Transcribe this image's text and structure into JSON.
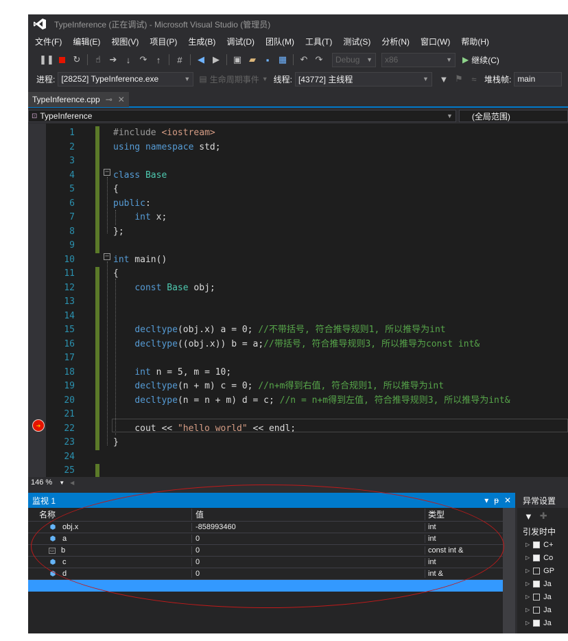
{
  "window": {
    "title": "TypeInference (正在调试) - Microsoft Visual Studio (管理员)"
  },
  "menu": [
    "文件(F)",
    "编辑(E)",
    "视图(V)",
    "项目(P)",
    "生成(B)",
    "调试(D)",
    "团队(M)",
    "工具(T)",
    "测试(S)",
    "分析(N)",
    "窗口(W)",
    "帮助(H)"
  ],
  "toolbar": {
    "config": "Debug",
    "platform": "x86",
    "continue_label": "继续(C)"
  },
  "debugbar": {
    "process_label": "进程:",
    "process_value": "[28252] TypeInference.exe",
    "lifecycle_label": "生命周期事件",
    "thread_label": "线程:",
    "thread_value": "[43772] 主线程",
    "stack_label": "堆栈帧:",
    "stack_value": "main"
  },
  "tab": {
    "filename": "TypeInference.cpp"
  },
  "nav": {
    "project": "TypeInference",
    "scope": "(全局范围)"
  },
  "editor": {
    "zoom": "146 %",
    "current_line": 22,
    "lines": [
      {
        "n": 1,
        "t": [
          [
            "pp",
            "#include "
          ],
          [
            "st",
            "<iostream>"
          ]
        ]
      },
      {
        "n": 2,
        "t": [
          [
            "kw",
            "using"
          ],
          [
            "tx",
            " "
          ],
          [
            "kw",
            "namespace"
          ],
          [
            "tx",
            " std;"
          ]
        ]
      },
      {
        "n": 3,
        "t": []
      },
      {
        "n": 4,
        "t": [
          [
            "kw",
            "class"
          ],
          [
            "tx",
            " "
          ],
          [
            "ty",
            "Base"
          ]
        ]
      },
      {
        "n": 5,
        "t": [
          [
            "tx",
            "{"
          ]
        ]
      },
      {
        "n": 6,
        "t": [
          [
            "kw",
            "public"
          ],
          [
            "tx",
            ":"
          ]
        ]
      },
      {
        "n": 7,
        "t": [
          [
            "tx",
            "    "
          ],
          [
            "kw",
            "int"
          ],
          [
            "tx",
            " x;"
          ]
        ]
      },
      {
        "n": 8,
        "t": [
          [
            "tx",
            "};"
          ]
        ]
      },
      {
        "n": 9,
        "t": []
      },
      {
        "n": 10,
        "t": [
          [
            "kw",
            "int"
          ],
          [
            "tx",
            " main()"
          ]
        ]
      },
      {
        "n": 11,
        "t": [
          [
            "tx",
            "{"
          ]
        ]
      },
      {
        "n": 12,
        "t": [
          [
            "tx",
            "    "
          ],
          [
            "kw",
            "const"
          ],
          [
            "tx",
            " "
          ],
          [
            "ty",
            "Base"
          ],
          [
            "tx",
            " obj;"
          ]
        ]
      },
      {
        "n": 13,
        "t": []
      },
      {
        "n": 14,
        "t": []
      },
      {
        "n": 15,
        "t": [
          [
            "tx",
            "    "
          ],
          [
            "kw",
            "decltype"
          ],
          [
            "tx",
            "(obj.x) a = 0; "
          ],
          [
            "cm",
            "//不带括号, 符合推导规则1, 所以推导为int"
          ]
        ]
      },
      {
        "n": 16,
        "t": [
          [
            "tx",
            "    "
          ],
          [
            "kw",
            "decltype"
          ],
          [
            "tx",
            "((obj.x)) b = a;"
          ],
          [
            "cm",
            "//带括号, 符合推导规则3, 所以推导为const int&"
          ]
        ]
      },
      {
        "n": 17,
        "t": []
      },
      {
        "n": 18,
        "t": [
          [
            "tx",
            "    "
          ],
          [
            "kw",
            "int"
          ],
          [
            "tx",
            " n = 5, m = 10;"
          ]
        ]
      },
      {
        "n": 19,
        "t": [
          [
            "tx",
            "    "
          ],
          [
            "kw",
            "decltype"
          ],
          [
            "tx",
            "(n + m) c = 0; "
          ],
          [
            "cm",
            "//n+m得到右值, 符合规则1, 所以推导为int"
          ]
        ]
      },
      {
        "n": 20,
        "t": [
          [
            "tx",
            "    "
          ],
          [
            "kw",
            "decltype"
          ],
          [
            "tx",
            "(n = n + m) d = c; "
          ],
          [
            "cm",
            "//n = n+m得到左值, 符合推导规则3, 所以推导为int&"
          ]
        ]
      },
      {
        "n": 21,
        "t": []
      },
      {
        "n": 22,
        "t": [
          [
            "tx",
            "    cout << "
          ],
          [
            "st",
            "\"hello world\""
          ],
          [
            "tx",
            " << endl;"
          ]
        ]
      },
      {
        "n": 23,
        "t": [
          [
            "tx",
            "}"
          ]
        ]
      },
      {
        "n": 24,
        "t": []
      },
      {
        "n": 25,
        "t": []
      }
    ]
  },
  "watch": {
    "title": "监视 1",
    "columns": {
      "name": "名称",
      "value": "值",
      "type": "类型"
    },
    "rows": [
      {
        "name": "obj.x",
        "value": "-858993460",
        "type": "int",
        "icon": "field-icon"
      },
      {
        "name": "a",
        "value": "0",
        "type": "int",
        "icon": "field-icon"
      },
      {
        "name": "b",
        "value": "0",
        "type": "const int &",
        "icon": "reference-icon"
      },
      {
        "name": "c",
        "value": "0",
        "type": "int",
        "icon": "field-icon"
      },
      {
        "name": "d",
        "value": "0",
        "type": "int &",
        "icon": "field-icon"
      }
    ]
  },
  "exceptions": {
    "title": "异常设置",
    "trigger_label": "引发时中",
    "items": [
      {
        "label": "C+",
        "checked": true
      },
      {
        "label": "Co",
        "checked": true
      },
      {
        "label": "GP",
        "checked": false
      },
      {
        "label": "Ja",
        "checked": true
      },
      {
        "label": "Ja",
        "checked": false
      },
      {
        "label": "Ja",
        "checked": false
      },
      {
        "label": "Ja",
        "checked": true
      }
    ]
  },
  "colors": {
    "accent": "#007acc",
    "editor_bg": "#1e1e1e",
    "annotation": "#c11a1a"
  }
}
